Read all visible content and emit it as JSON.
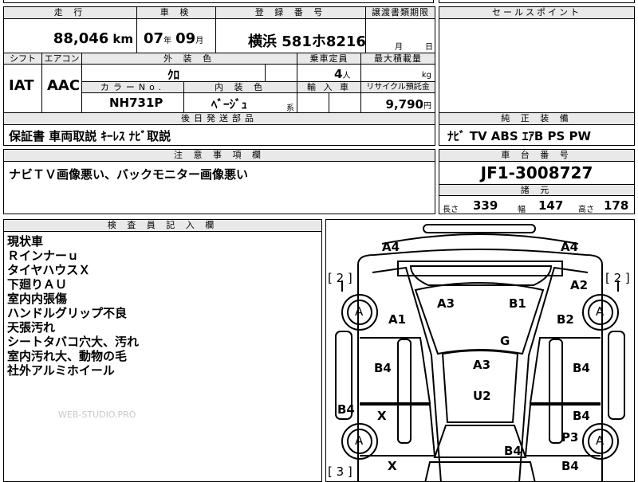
{
  "mileage": {
    "header": "走 行",
    "value": "88,046",
    "unit": "km"
  },
  "inspection": {
    "header": "車 検",
    "year": "07",
    "year_unit": "年",
    "month": "09",
    "month_unit": "月"
  },
  "registration": {
    "header": "登 録 番 号",
    "value": "横浜 581ホ8216"
  },
  "transfer_deadline": {
    "header": "譲渡書類期限",
    "month_unit": "月",
    "day_unit": "日"
  },
  "sales_point": {
    "header": "セールスポイント"
  },
  "shift": {
    "header": "シフト",
    "value": "IAT"
  },
  "aircon": {
    "header": "エアコン",
    "value": "AAC"
  },
  "exterior_color": {
    "header": "外 装 色",
    "value": "ｸﾛ"
  },
  "capacity": {
    "header": "乗車定員",
    "value": "4",
    "unit": "人"
  },
  "max_load": {
    "header": "最大積載量",
    "unit": "kg"
  },
  "color_no": {
    "header": "カラーNo.",
    "value": "NH731P"
  },
  "interior_color": {
    "header": "内 装 色",
    "value": "ﾍﾞｰｼﾞｭ",
    "suffix": "系"
  },
  "import": {
    "header": "輸 入 車"
  },
  "recycle": {
    "header": "リサイクル預託金",
    "value": "9,790",
    "unit": "円"
  },
  "accessories": {
    "header": "後日発送部品",
    "value": "保証書 車両取説 ｷｰﾚｽ ﾅﾋﾞ取説"
  },
  "equipment": {
    "header": "純 正 装 備",
    "value": "ﾅﾋﾞ TV ABS ｴｱB PS PW"
  },
  "caution": {
    "header": "注 意 事 項 欄",
    "value": "ナビＴＶ画像悪い、バックモニター画像悪い"
  },
  "chassis": {
    "header": "車 台 番 号",
    "value": "JF1-3008727"
  },
  "specs": {
    "header": "諸 元",
    "length_label": "長さ",
    "length": "339",
    "width_label": "幅",
    "width": "147",
    "height_label": "高さ",
    "height": "178"
  },
  "inspector": {
    "header": "検 査 員 記 入 欄",
    "notes": [
      "現状車",
      "Ｒインナーｕ",
      "タイヤハウスＸ",
      "下廻りＡＵ",
      "室内内張傷",
      "ハンドルグリップ不良",
      "天張汚れ",
      "シートタバコ穴大、汚れ",
      "室内汚れ大、動物の毛",
      "社外アルミホイール"
    ]
  },
  "watermark": "WEB-STUDIO.PRO",
  "damage_map": {
    "labels": {
      "a4_left": "A4",
      "a4_right": "A4",
      "bracket_2_left": "[ 2 ]",
      "bracket_2_right": "[ 2 ]",
      "bracket_3_left": "[ 3 ]",
      "a2": "A2",
      "a3_top": "A3",
      "b1": "B1",
      "a1": "A1",
      "b2": "B2",
      "g": "G",
      "b4_left_mid": "B4",
      "a3_center": "A3",
      "b4_right_mid": "B4",
      "u2": "U2",
      "b4_left_low": "B4",
      "x_left": "X",
      "b4_right_low": "B4",
      "p3": "P3",
      "x_bottom": "X",
      "b4_bottom_center": "B4",
      "b4_bottom_right": "B4",
      "wheel_fl": "A",
      "wheel_fr": "A",
      "wheel_rl": "A",
      "wheel_rr": "A"
    }
  }
}
